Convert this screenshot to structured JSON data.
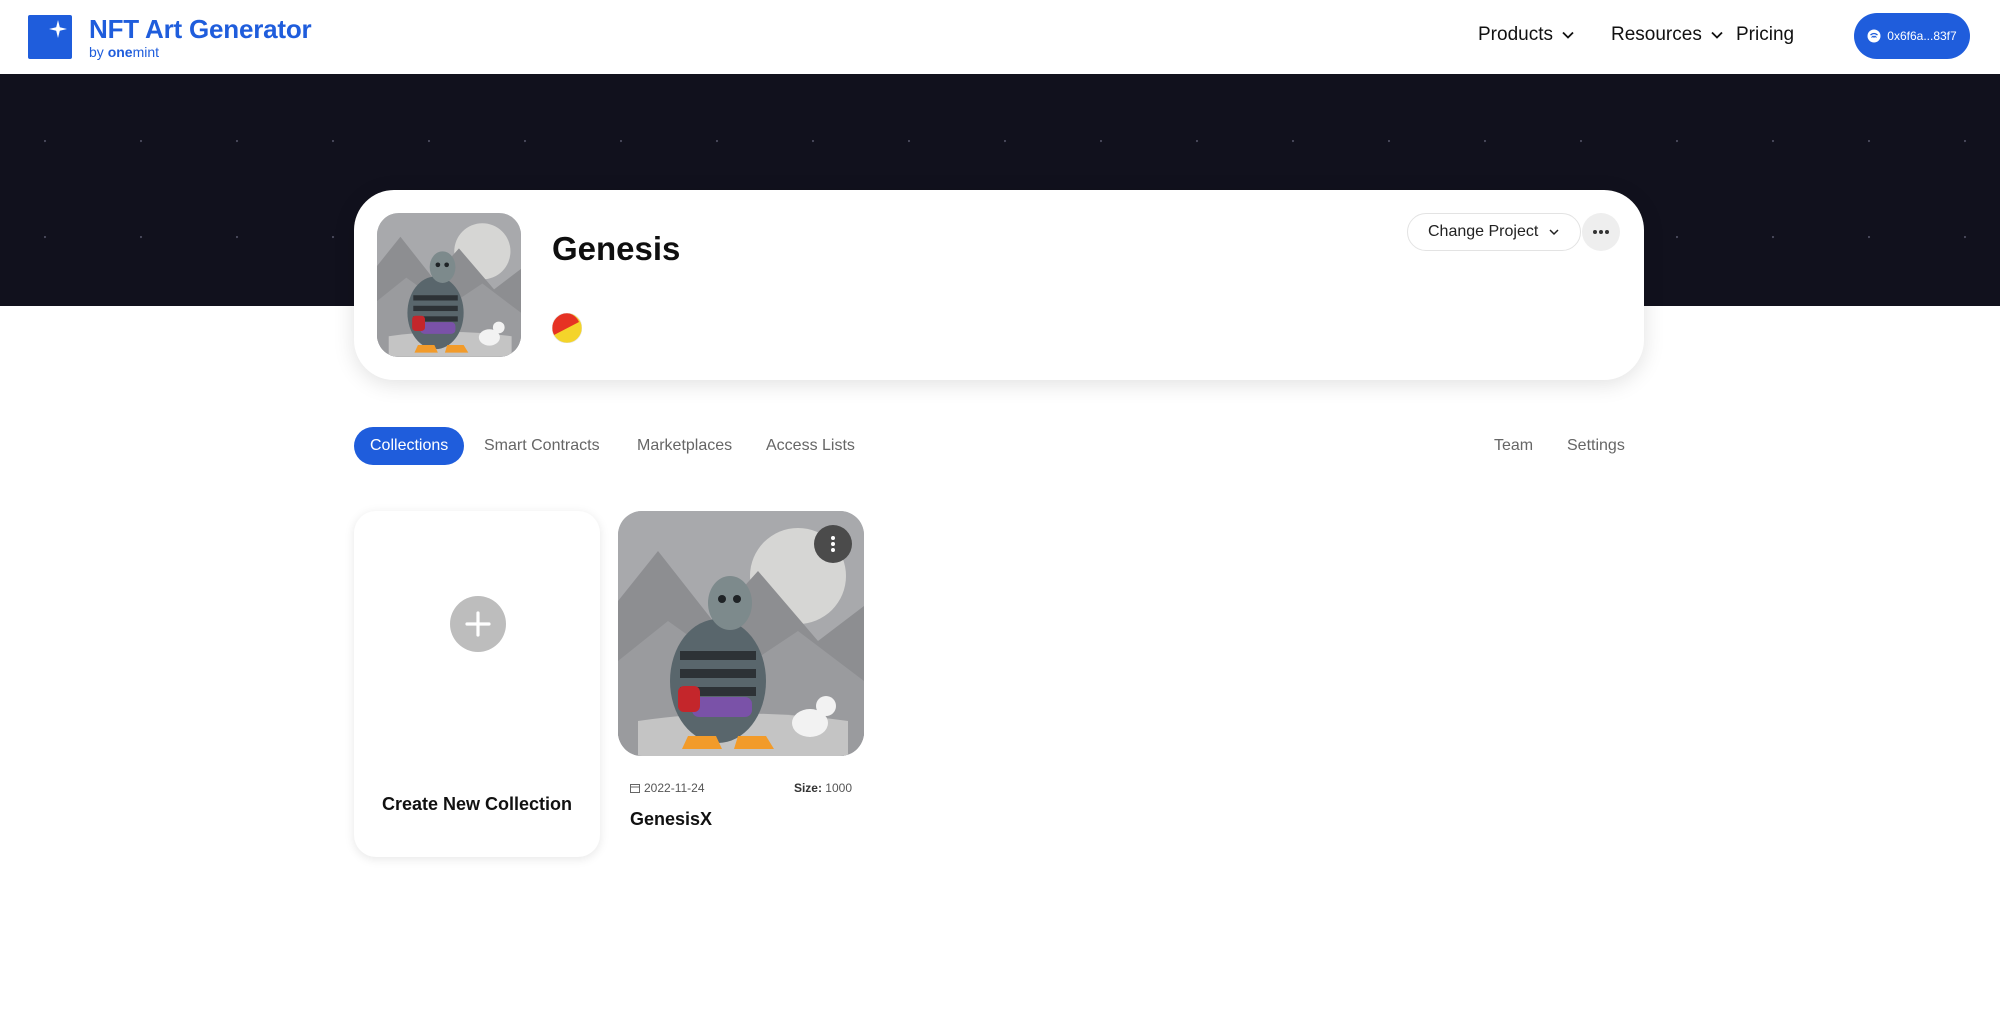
{
  "brand": {
    "title": "NFT Art Generator",
    "by": "by",
    "sub_bold": "one",
    "sub_rest": "mint",
    "color": "#1f5ddc"
  },
  "nav": {
    "products": "Products",
    "resources": "Resources",
    "pricing": "Pricing",
    "wallet": "0x6f6a...83f7"
  },
  "banner": {
    "color": "#11111d"
  },
  "project": {
    "name": "Genesis",
    "change_project_label": "Change Project",
    "more_icon": "more-horizontal-icon",
    "chain_icon": "chain-logo-icon"
  },
  "tabs": {
    "collections": "Collections",
    "smart_contracts": "Smart Contracts",
    "marketplaces": "Marketplaces",
    "access_lists": "Access Lists",
    "team": "Team",
    "settings": "Settings",
    "active": "Collections"
  },
  "create_card": {
    "label": "Create New Collection",
    "icon": "plus-icon"
  },
  "collections": [
    {
      "name": "GenesisX",
      "date": "2022-11-24",
      "size_label": "Size:",
      "size_value": "1000",
      "menu_icon": "more-vertical-icon"
    }
  ]
}
